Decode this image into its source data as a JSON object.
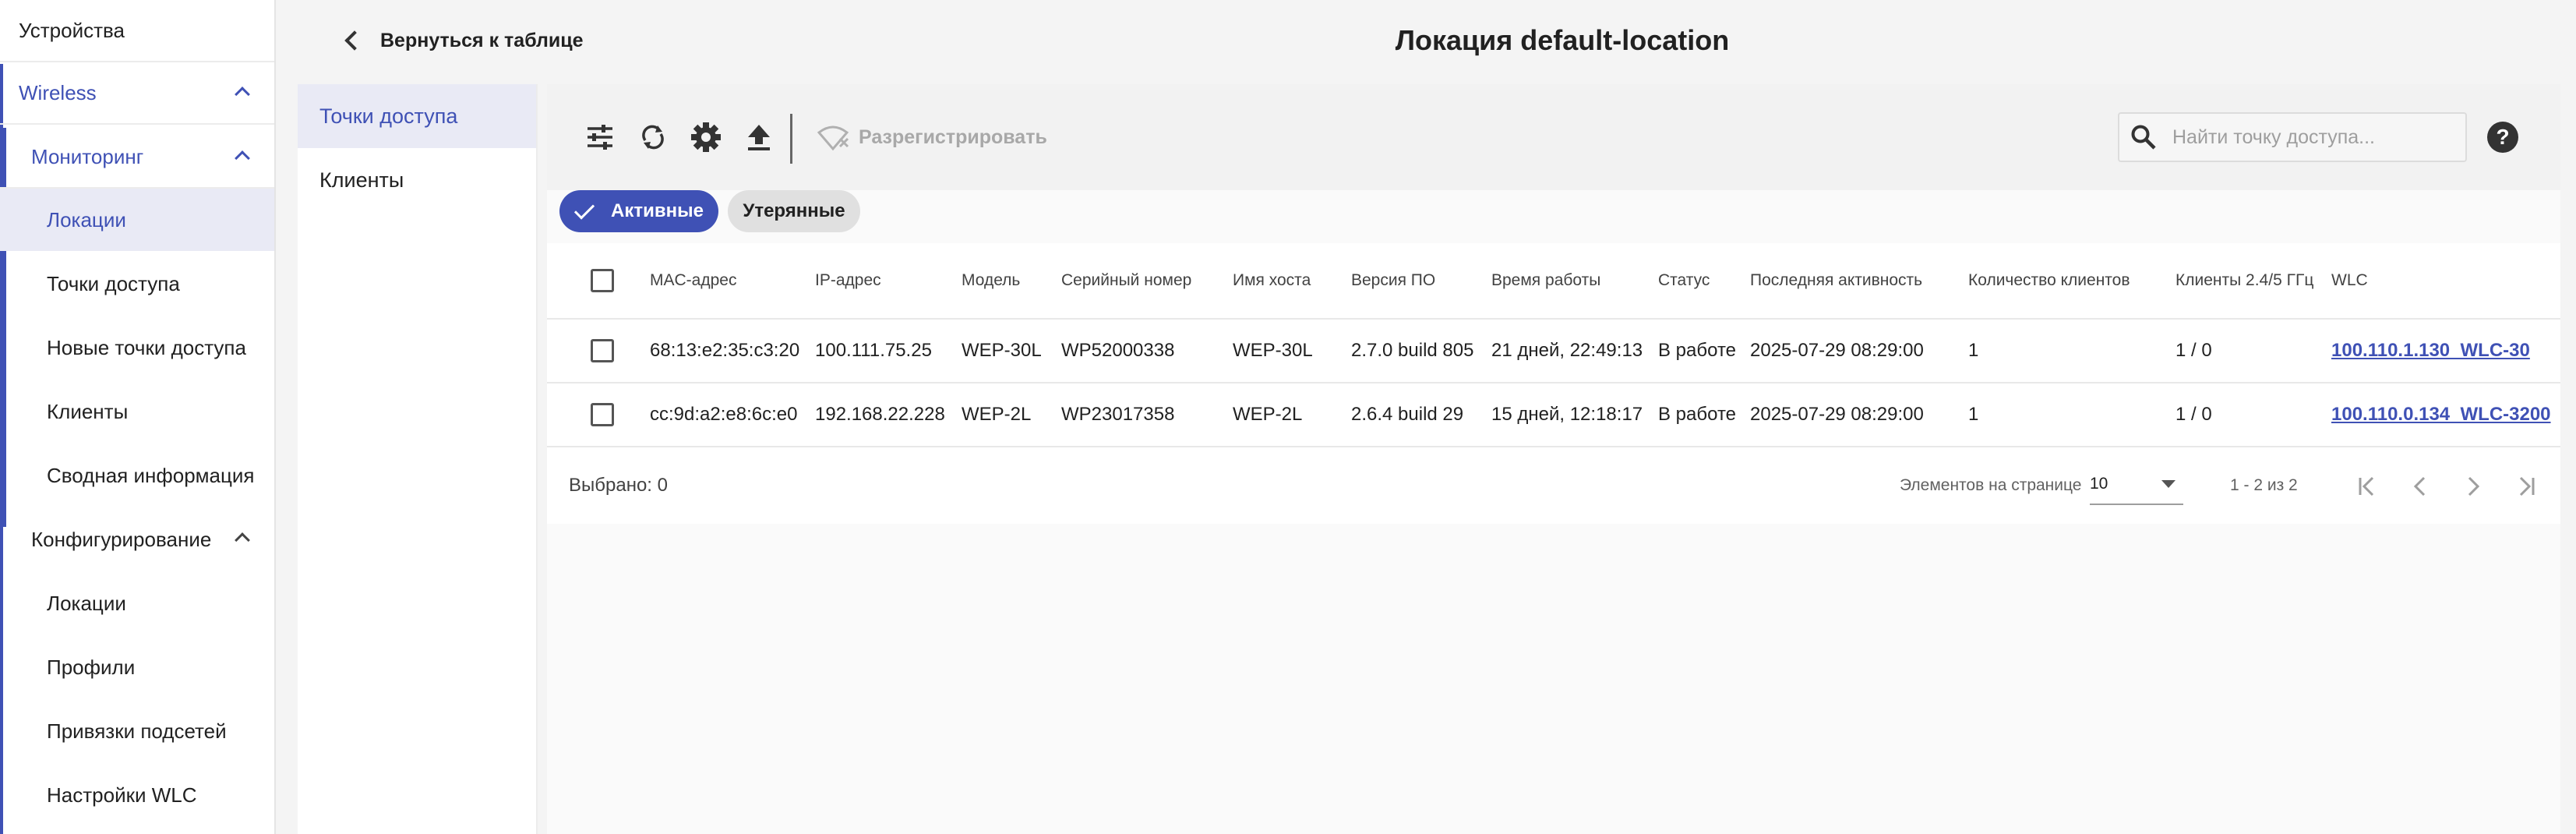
{
  "nav": {
    "devices": "Устройства",
    "wireless": "Wireless",
    "monitoring": "Мониторинг",
    "monitoring_items": [
      "Локации",
      "Точки доступа",
      "Новые точки доступа",
      "Клиенты",
      "Сводная информация"
    ],
    "config": "Конфигурирование",
    "config_items": [
      "Локации",
      "Профили",
      "Привязки подсетей",
      "Настройки WLC"
    ]
  },
  "header": {
    "back_label": "Вернуться к таблице",
    "title": "Локация default-location"
  },
  "subnav": {
    "tabs": [
      "Точки доступа",
      "Клиенты"
    ]
  },
  "toolbar": {
    "unregister_label": "Разрегистрировать",
    "search_placeholder": "Найти точку доступа...",
    "help_label": "?"
  },
  "filters": {
    "active_label": "Активные",
    "lost_label": "Утерянные"
  },
  "table": {
    "columns": [
      "MAC-адрес",
      "IP-адрес",
      "Модель",
      "Серийный номер",
      "Имя хоста",
      "Версия ПО",
      "Время работы",
      "Статус",
      "Последняя активность",
      "Количество клиентов",
      "Клиенты 2.4/5 ГГц",
      "WLC"
    ],
    "rows": [
      [
        "68:13:e2:35:c3:20",
        "100.111.75.25",
        "WEP-30L",
        "WP52000338",
        "WEP-30L",
        "2.7.0 build 805",
        "21 дней, 22:49:13",
        "В работе",
        "2025-07-29 08:29:00",
        "1",
        "1 / 0",
        "100.110.1.130_WLC-30"
      ],
      [
        "cc:9d:a2:e8:6c:e0",
        "192.168.22.228",
        "WEP-2L",
        "WP23017358",
        "WEP-2L",
        "2.6.4 build 29",
        "15 дней, 12:18:17",
        "В работе",
        "2025-07-29 08:29:00",
        "1",
        "1 / 0",
        "100.110.0.134_WLC-3200"
      ]
    ]
  },
  "footer": {
    "selected": "Выбрано: 0",
    "per_page_label": "Элементов на странице",
    "per_page_value": "10",
    "range": "1 - 2 из 2"
  },
  "colors": {
    "accent": "#3f51b5",
    "active_bg": "#e9eaf5"
  }
}
